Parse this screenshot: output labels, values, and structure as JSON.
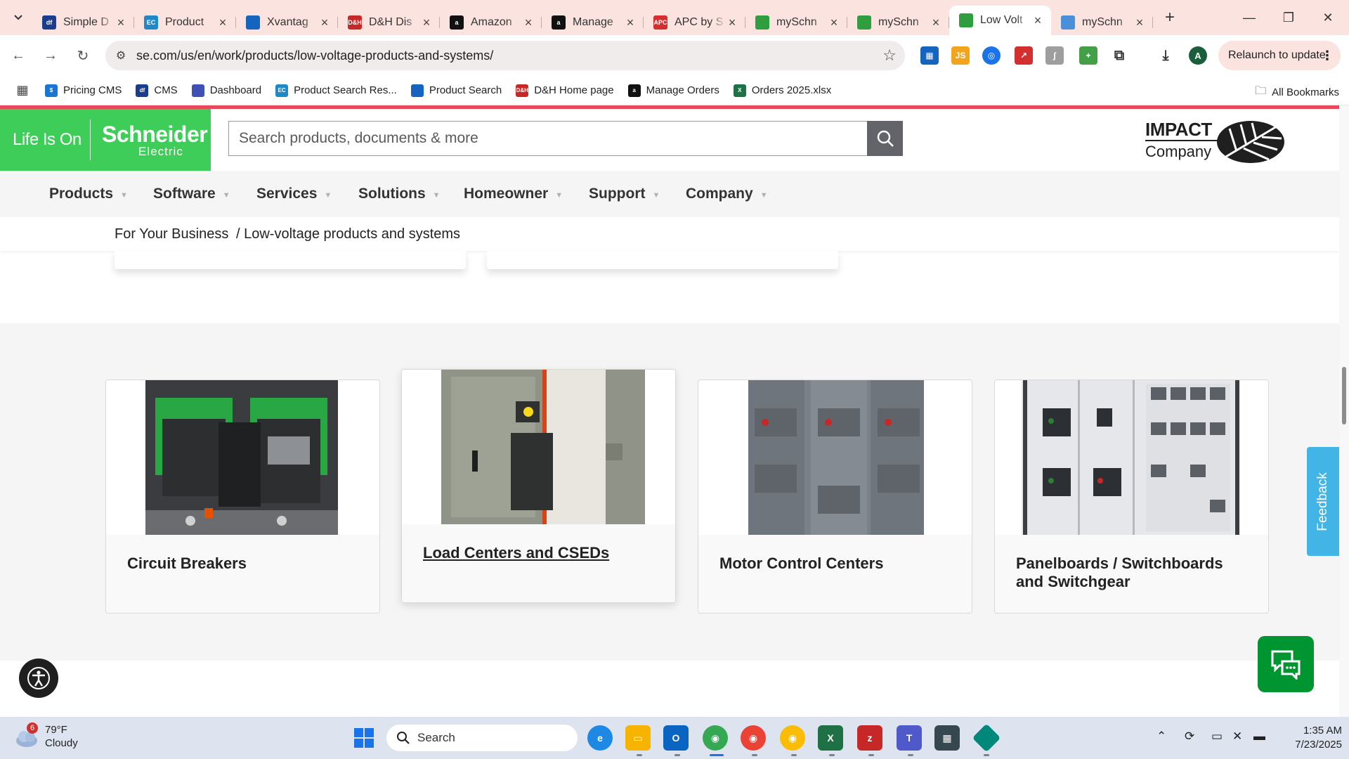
{
  "browser": {
    "tabs": [
      {
        "title": "Simple D",
        "fav_color": "#1a3d8f",
        "fav_text": "df"
      },
      {
        "title": "Product",
        "fav_color": "#1e88c9",
        "fav_text": "EC"
      },
      {
        "title": "Xvantag",
        "fav_color": "#1565c0",
        "fav_text": ""
      },
      {
        "title": "D&H Dis",
        "fav_color": "#c62828",
        "fav_text": "D&H"
      },
      {
        "title": "Amazon",
        "fav_color": "#111111",
        "fav_text": "a"
      },
      {
        "title": "Manage",
        "fav_color": "#111111",
        "fav_text": "a"
      },
      {
        "title": "APC by S",
        "fav_color": "#d32f2f",
        "fav_text": "APC"
      },
      {
        "title": "mySchn",
        "fav_color": "#2e9e3f",
        "fav_text": ""
      },
      {
        "title": "mySchn",
        "fav_color": "#2e9e3f",
        "fav_text": ""
      },
      {
        "title": "Low Volt",
        "fav_color": "#2e9e3f",
        "fav_text": ""
      },
      {
        "title": "mySchn",
        "fav_color": "#4a90d9",
        "fav_text": ""
      }
    ],
    "active_tab_index": 9,
    "url": "se.com/us/en/work/products/low-voltage-products-and-systems/",
    "relaunch_label": "Relaunch to update",
    "profile_initial": "A",
    "bookmarks": [
      {
        "label": "Pricing CMS",
        "fav_color": "#1976d2",
        "fav_text": "$"
      },
      {
        "label": "CMS",
        "fav_color": "#1a3d8f",
        "fav_text": "df"
      },
      {
        "label": "Dashboard",
        "fav_color": "#3f51b5",
        "fav_text": ""
      },
      {
        "label": "Product Search Res...",
        "fav_color": "#1e88c9",
        "fav_text": "EC"
      },
      {
        "label": "Product Search",
        "fav_color": "#1565c0",
        "fav_text": ""
      },
      {
        "label": "D&H Home page",
        "fav_color": "#c62828",
        "fav_text": "D&H"
      },
      {
        "label": "Manage Orders",
        "fav_color": "#111111",
        "fav_text": "a"
      },
      {
        "label": "Orders 2025.xlsx",
        "fav_color": "#1e7145",
        "fav_text": "X"
      }
    ],
    "all_bookmarks_label": "All Bookmarks"
  },
  "site": {
    "logo_life_is_on": "Life Is On",
    "logo_brand_1": "Schneider",
    "logo_brand_2": "Electric",
    "search_placeholder": "Search products, documents & more",
    "impact_line1": "IMPACT",
    "impact_line2": "Company",
    "nav": [
      "Products",
      "Software",
      "Services",
      "Solutions",
      "Homeowner",
      "Support",
      "Company"
    ],
    "breadcrumb": [
      "For Your Business",
      "/ Low-voltage products and systems"
    ],
    "cards": [
      {
        "label": "Circuit Breakers"
      },
      {
        "label": "Load Centers and CSEDs"
      },
      {
        "label": "Motor Control Centers"
      },
      {
        "label": "Panelboards / Switchboards and Switchgear"
      }
    ],
    "hovered_card_index": 1,
    "feedback_label": "Feedback"
  },
  "taskbar": {
    "weather_temp": "79°F",
    "weather_desc": "Cloudy",
    "weather_badge": "6",
    "search_label": "Search",
    "time": "1:35 AM",
    "date": "7/23/2025"
  },
  "colors": {
    "brand_green": "#3dcd58",
    "accent_red": "#e8495a",
    "feedback_blue": "#42b4e6",
    "chat_green": "#009530",
    "tab_strip": "#fbe3df"
  }
}
